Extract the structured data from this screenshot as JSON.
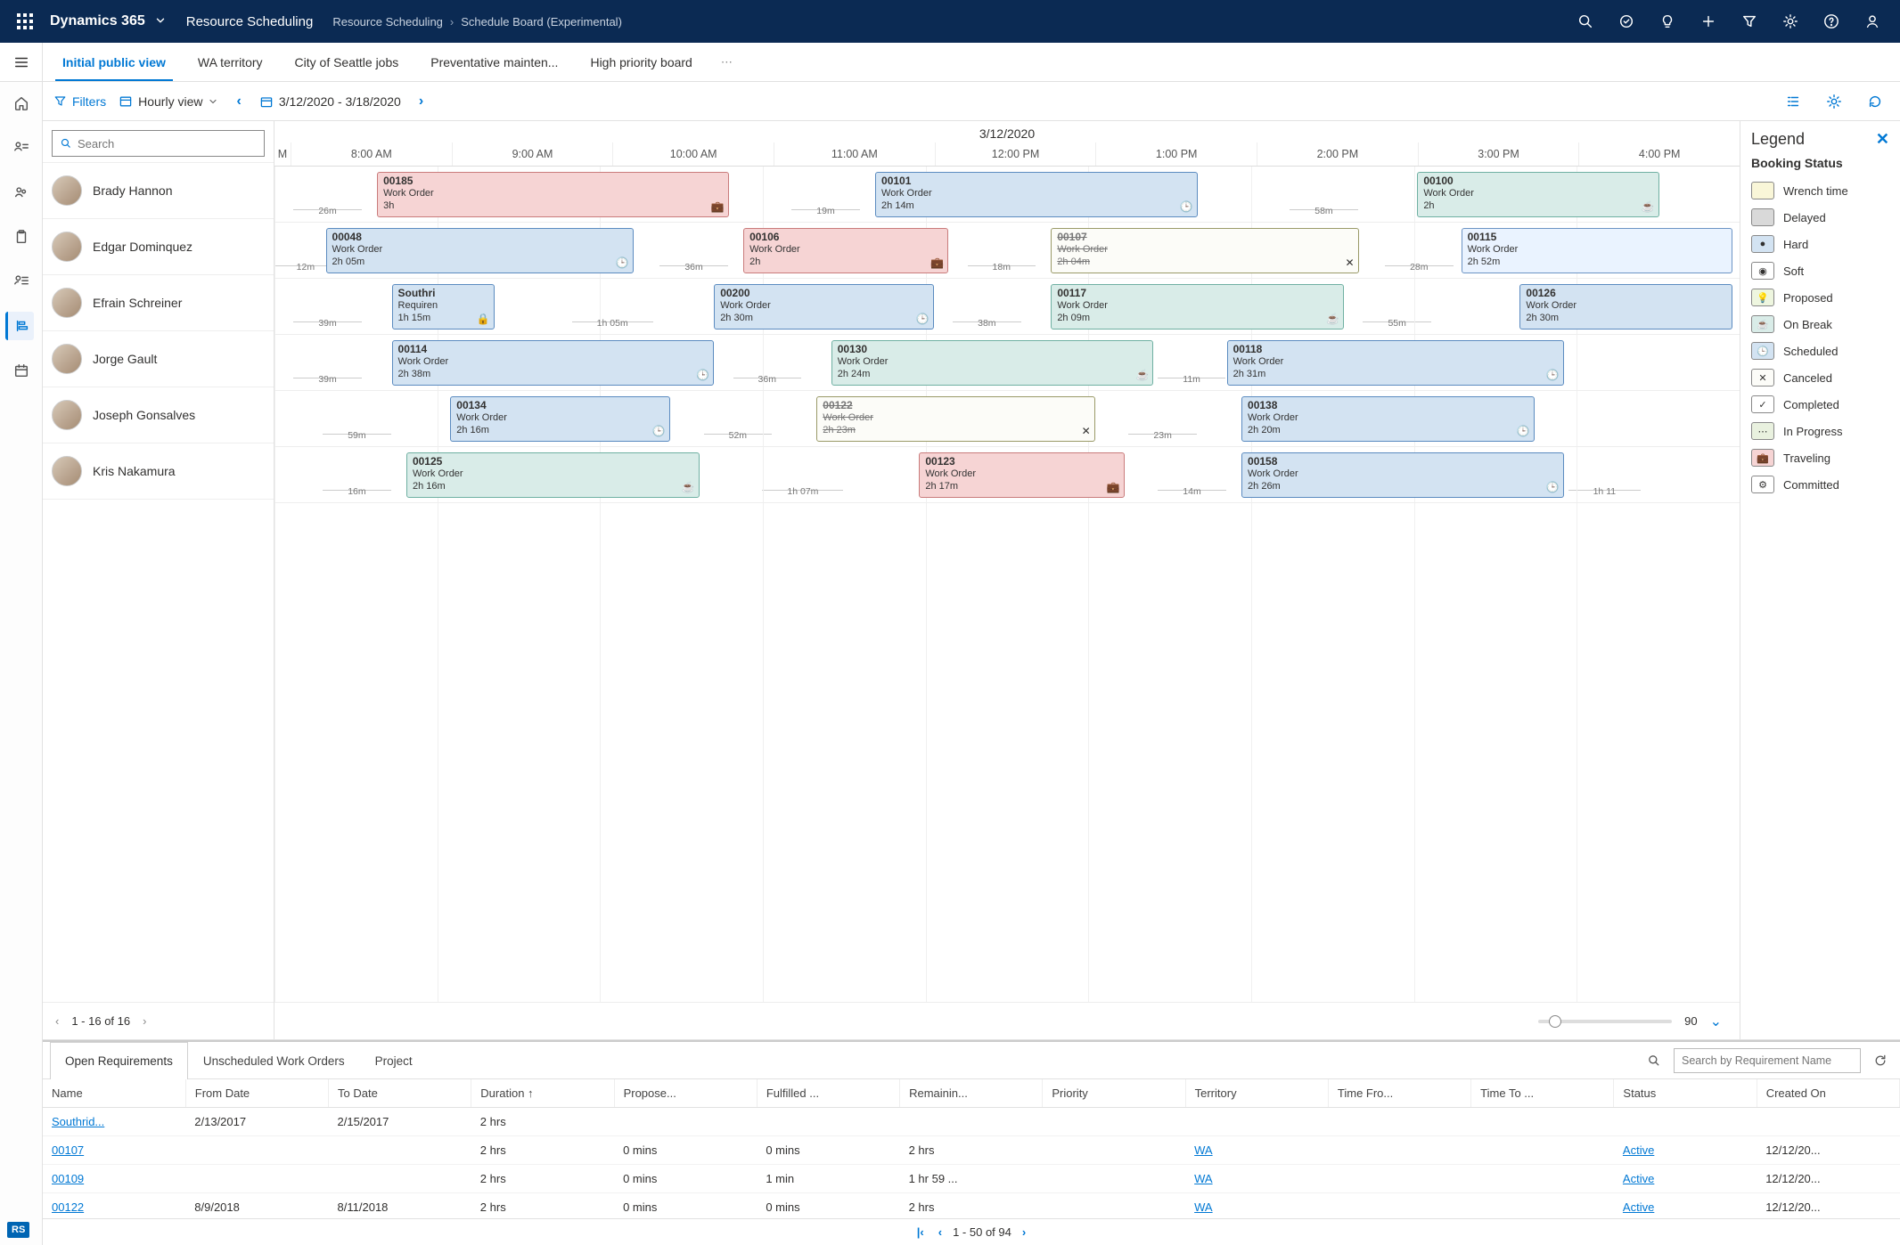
{
  "topbar": {
    "brand": "Dynamics 365",
    "area": "Resource Scheduling",
    "crumb1": "Resource Scheduling",
    "crumb2": "Schedule Board (Experimental)"
  },
  "tabs": [
    "Initial public view",
    "WA territory",
    "City of Seattle jobs",
    "Preventative mainten...",
    "High priority board"
  ],
  "toolbar": {
    "filters": "Filters",
    "view": "Hourly view",
    "range": "3/12/2020 - 3/18/2020"
  },
  "search": {
    "placeholder": "Search"
  },
  "resources": [
    "Brady Hannon",
    "Edgar Dominquez",
    "Efrain Schreiner",
    "Jorge Gault",
    "Joseph Gonsalves",
    "Kris Nakamura"
  ],
  "pager": "1 - 16 of 16",
  "gantt": {
    "date": "3/12/2020",
    "hours": [
      "8:00 AM",
      "9:00 AM",
      "10:00 AM",
      "11:00 AM",
      "12:00 PM",
      "1:00 PM",
      "2:00 PM",
      "3:00 PM",
      "4:00 PM"
    ],
    "left_stub": "M",
    "slider_value": "90",
    "rows": [
      {
        "gaps": [
          {
            "left": "3%",
            "label": "26m"
          },
          {
            "left": "37%",
            "label": "19m"
          },
          {
            "left": "71%",
            "label": "58m"
          }
        ],
        "cards": [
          {
            "id": "00185",
            "type": "Work Order",
            "dur": "3h",
            "left": "7%",
            "width": "24%",
            "cls": "c-travel",
            "icon": "briefcase"
          },
          {
            "id": "00101",
            "type": "Work Order",
            "dur": "2h 14m",
            "left": "41%",
            "width": "22%",
            "cls": "c-sched",
            "icon": "clock"
          },
          {
            "id": "00100",
            "type": "Work Order",
            "dur": "2h",
            "left": "78%",
            "width": "16.5%",
            "cls": "c-break",
            "icon": "cup"
          }
        ]
      },
      {
        "gaps": [
          {
            "left": "1.5%",
            "label": "12m"
          },
          {
            "left": "28%",
            "label": "36m"
          },
          {
            "left": "49%",
            "label": "18m"
          },
          {
            "left": "77.5%",
            "label": "28m"
          }
        ],
        "cards": [
          {
            "id": "00048",
            "type": "Work Order",
            "dur": "2h 05m",
            "left": "3.5%",
            "width": "21%",
            "cls": "c-sched",
            "icon": "clock"
          },
          {
            "id": "00106",
            "type": "Work Order",
            "dur": "2h",
            "left": "32%",
            "width": "14%",
            "cls": "c-travel",
            "icon": "briefcase"
          },
          {
            "id": "00107",
            "type": "Work Order",
            "dur": "2h 04m",
            "left": "53%",
            "width": "21%",
            "cls": "c-cancel",
            "icon": "cancel",
            "extra": "cancel"
          },
          {
            "id": "00115",
            "type": "Work Order",
            "dur": "2h 52m",
            "left": "81%",
            "width": "18.5%",
            "cls": "c-hard",
            "icon": ""
          }
        ]
      },
      {
        "gaps": [
          {
            "left": "3%",
            "label": "39m"
          },
          {
            "left": "22%",
            "label": "1h 05m"
          },
          {
            "left": "48%",
            "label": "38m"
          },
          {
            "left": "76%",
            "label": "55m"
          }
        ],
        "cards": [
          {
            "id": "Southri",
            "type": "Requiren",
            "dur": "1h 15m",
            "left": "8%",
            "width": "7%",
            "cls": "c-sched",
            "icon": "lock"
          },
          {
            "id": "00200",
            "type": "Work Order",
            "dur": "2h 30m",
            "left": "30%",
            "width": "15%",
            "cls": "c-sched",
            "icon": "clock"
          },
          {
            "id": "00117",
            "type": "Work Order",
            "dur": "2h 09m",
            "left": "53%",
            "width": "20%",
            "cls": "c-break",
            "icon": "cup"
          },
          {
            "id": "00126",
            "type": "Work Order",
            "dur": "2h 30m",
            "left": "85%",
            "width": "14.5%",
            "cls": "c-sched",
            "icon": ""
          }
        ]
      },
      {
        "gaps": [
          {
            "left": "3%",
            "label": "39m"
          },
          {
            "left": "33%",
            "label": "36m"
          },
          {
            "left": "62%",
            "label": "11m"
          }
        ],
        "cards": [
          {
            "id": "00114",
            "type": "Work Order",
            "dur": "2h 38m",
            "left": "8%",
            "width": "22%",
            "cls": "c-sched",
            "icon": "clock"
          },
          {
            "id": "00130",
            "type": "Work Order",
            "dur": "2h 24m",
            "left": "38%",
            "width": "22%",
            "cls": "c-break",
            "icon": "cup"
          },
          {
            "id": "00118",
            "type": "Work Order",
            "dur": "2h 31m",
            "left": "65%",
            "width": "23%",
            "cls": "c-sched",
            "icon": "clock"
          }
        ]
      },
      {
        "gaps": [
          {
            "left": "5%",
            "label": "59m"
          },
          {
            "left": "31%",
            "label": "52m"
          },
          {
            "left": "60%",
            "label": "23m"
          }
        ],
        "cards": [
          {
            "id": "00134",
            "type": "Work Order",
            "dur": "2h 16m",
            "left": "12%",
            "width": "15%",
            "cls": "c-sched",
            "icon": "clock"
          },
          {
            "id": "00122",
            "type": "Work Order",
            "dur": "2h 23m",
            "left": "37%",
            "width": "19%",
            "cls": "c-cancel",
            "icon": "cancel",
            "extra": "cancel"
          },
          {
            "id": "00138",
            "type": "Work Order",
            "dur": "2h 20m",
            "left": "66%",
            "width": "20%",
            "cls": "c-sched",
            "icon": "clock"
          }
        ]
      },
      {
        "gaps": [
          {
            "left": "5%",
            "label": "16m"
          },
          {
            "left": "35%",
            "label": "1h 07m"
          },
          {
            "left": "62%",
            "label": "14m"
          },
          {
            "left": "90%",
            "label": "1h 11"
          }
        ],
        "cards": [
          {
            "id": "00125",
            "type": "Work Order",
            "dur": "2h 16m",
            "left": "9%",
            "width": "20%",
            "cls": "c-break",
            "icon": "cup"
          },
          {
            "id": "00123",
            "type": "Work Order",
            "dur": "2h 17m",
            "left": "44%",
            "width": "14%",
            "cls": "c-travel",
            "icon": "briefcase"
          },
          {
            "id": "00158",
            "type": "Work Order",
            "dur": "2h 26m",
            "left": "66%",
            "width": "22%",
            "cls": "c-sched",
            "icon": "clock"
          }
        ]
      }
    ]
  },
  "legend": {
    "title": "Legend",
    "section": "Booking Status",
    "items": [
      {
        "label": "Wrench time",
        "color": "#f9f6d8",
        "icon": ""
      },
      {
        "label": "Delayed",
        "color": "#d9d9d9",
        "icon": ""
      },
      {
        "label": "Hard",
        "color": "#d3e3f2",
        "icon": "●"
      },
      {
        "label": "Soft",
        "color": "#ffffff",
        "icon": "◉"
      },
      {
        "label": "Proposed",
        "color": "#eef6df",
        "icon": "💡"
      },
      {
        "label": "On Break",
        "color": "#d9ece8",
        "icon": "☕"
      },
      {
        "label": "Scheduled",
        "color": "#d3e3f2",
        "icon": "🕒"
      },
      {
        "label": "Canceled",
        "color": "#fcfcf8",
        "icon": "✕"
      },
      {
        "label": "Completed",
        "color": "#ffffff",
        "icon": "✓"
      },
      {
        "label": "In Progress",
        "color": "#e9f1df",
        "icon": "⋯"
      },
      {
        "label": "Traveling",
        "color": "#f6d4d4",
        "icon": "💼"
      },
      {
        "label": "Committed",
        "color": "#ffffff",
        "icon": "⚙"
      }
    ]
  },
  "bottom": {
    "tabs": [
      "Open Requirements",
      "Unscheduled Work Orders",
      "Project"
    ],
    "search_ph": "Search by Requirement Name",
    "columns": [
      "Name",
      "From Date",
      "To Date",
      "Duration ↑",
      "Propose...",
      "Fulfilled ...",
      "Remainin...",
      "Priority",
      "Territory",
      "Time Fro...",
      "Time To ...",
      "Status",
      "Created On"
    ],
    "rows": [
      {
        "Name": "Southrid...",
        "From": "2/13/2017",
        "To": "2/15/2017",
        "Dur": "2 hrs",
        "Prop": "",
        "Ful": "",
        "Rem": "",
        "Pri": "",
        "Ter": "",
        "TF": "",
        "TT": "",
        "Stat": "",
        "Cr": ""
      },
      {
        "Name": "00107",
        "From": "",
        "To": "",
        "Dur": "2 hrs",
        "Prop": "0 mins",
        "Ful": "0 mins",
        "Rem": "2 hrs",
        "Pri": "",
        "Ter": "WA",
        "TF": "",
        "TT": "",
        "Stat": "Active",
        "Cr": "12/12/20..."
      },
      {
        "Name": "00109",
        "From": "",
        "To": "",
        "Dur": "2 hrs",
        "Prop": "0 mins",
        "Ful": "1 min",
        "Rem": "1 hr 59 ...",
        "Pri": "",
        "Ter": "WA",
        "TF": "",
        "TT": "",
        "Stat": "Active",
        "Cr": "12/12/20..."
      },
      {
        "Name": "00122",
        "From": "8/9/2018",
        "To": "8/11/2018",
        "Dur": "2 hrs",
        "Prop": "0 mins",
        "Ful": "0 mins",
        "Rem": "2 hrs",
        "Pri": "",
        "Ter": "WA",
        "TF": "",
        "TT": "",
        "Stat": "Active",
        "Cr": "12/12/20..."
      }
    ],
    "pager": "1 - 50 of 94"
  },
  "badge": "RS"
}
